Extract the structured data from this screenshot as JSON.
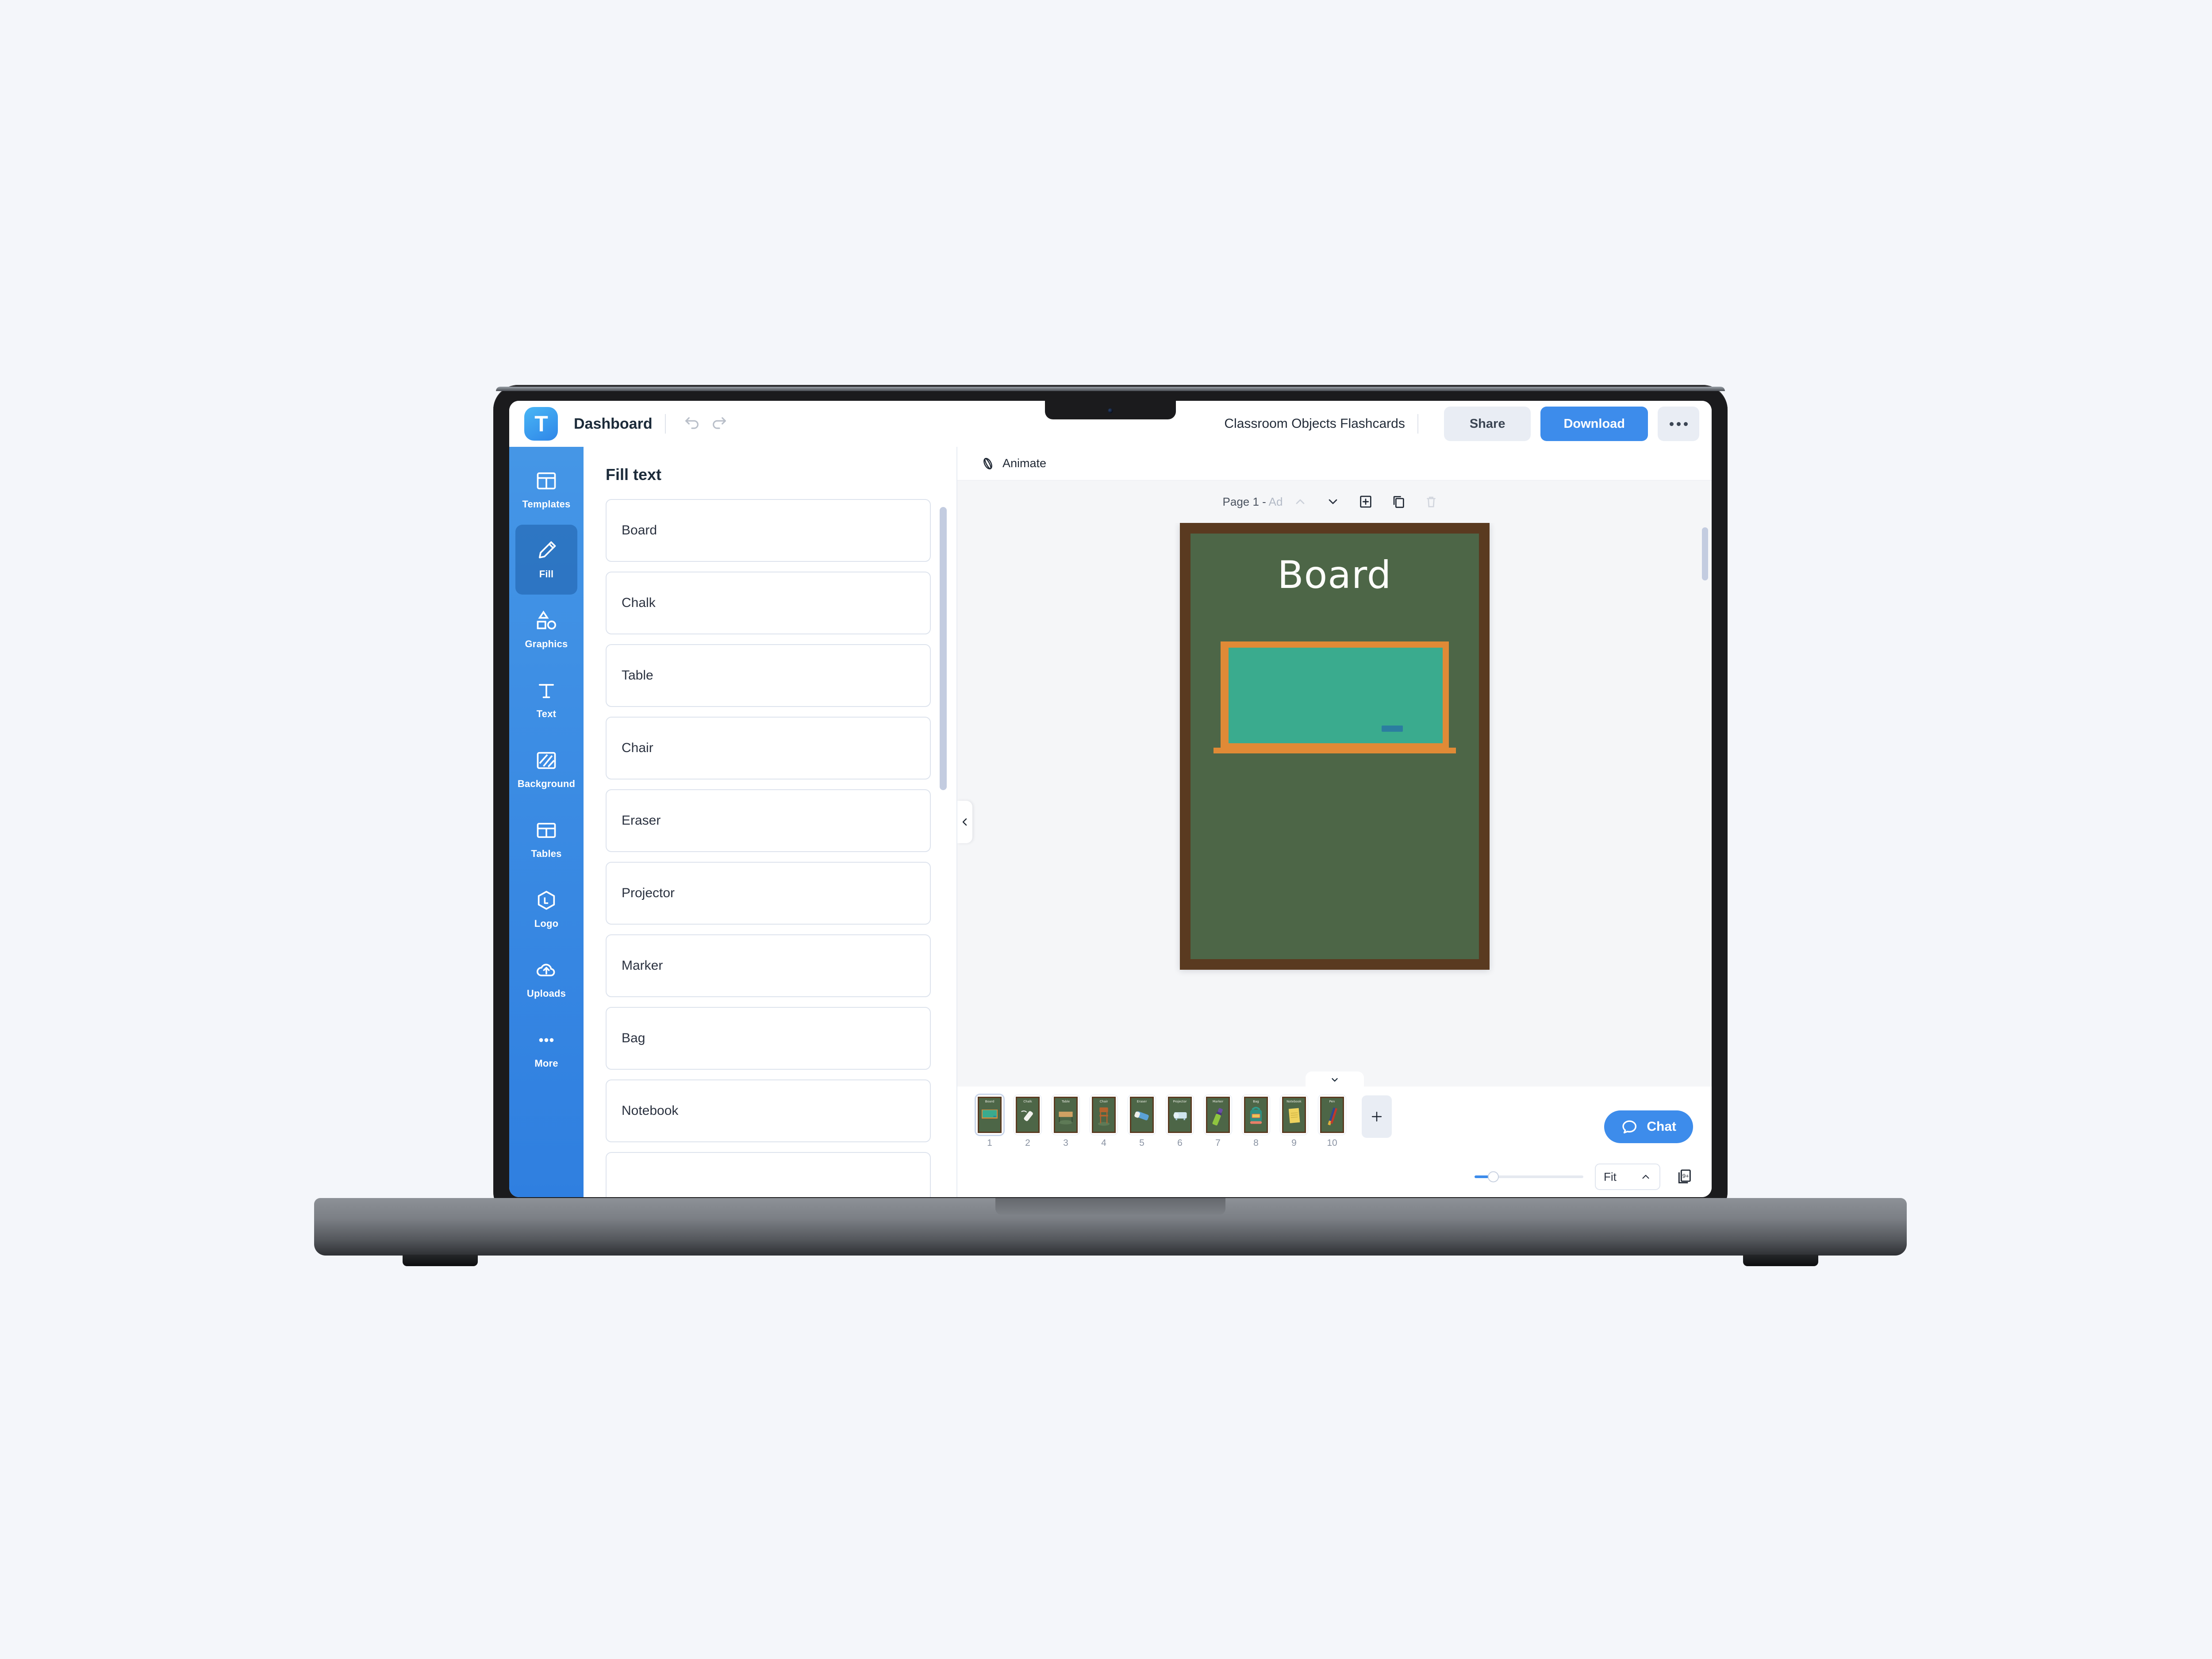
{
  "header": {
    "logo_letter": "T",
    "dashboard_label": "Dashboard",
    "undo_icon": "undo-icon",
    "redo_icon": "redo-icon",
    "doc_title": "Classroom Objects Flashcards",
    "share_label": "Share",
    "download_label": "Download",
    "more_icon": "more-horizontal-icon"
  },
  "sidebar": {
    "items": [
      {
        "label": "Templates",
        "icon": "templates-icon",
        "active": false
      },
      {
        "label": "Fill",
        "icon": "pencil-icon",
        "active": true
      },
      {
        "label": "Graphics",
        "icon": "shapes-icon",
        "active": false
      },
      {
        "label": "Text",
        "icon": "text-icon",
        "active": false
      },
      {
        "label": "Background",
        "icon": "background-icon",
        "active": false
      },
      {
        "label": "Tables",
        "icon": "tables-icon",
        "active": false
      },
      {
        "label": "Logo",
        "icon": "logo-icon",
        "active": false
      },
      {
        "label": "Uploads",
        "icon": "upload-cloud-icon",
        "active": false
      },
      {
        "label": "More",
        "icon": "more-dots-icon",
        "active": false
      }
    ]
  },
  "fill_panel": {
    "title": "Fill text",
    "fields": [
      {
        "value": "Board"
      },
      {
        "value": "Chalk"
      },
      {
        "value": "Table"
      },
      {
        "value": "Chair"
      },
      {
        "value": "Eraser"
      },
      {
        "value": "Projector"
      },
      {
        "value": "Marker"
      },
      {
        "value": "Bag"
      },
      {
        "value": "Notebook"
      },
      {
        "value": ""
      }
    ]
  },
  "editor": {
    "animate_label": "Animate",
    "animate_icon": "animate-icon",
    "page_indicator_prefix": "Page 1 - ",
    "page_indicator_suffix": "Ad",
    "prev_page_icon": "chevron-up-icon",
    "next_page_icon": "chevron-down-icon",
    "add_page_icon": "add-page-icon",
    "duplicate_page_icon": "duplicate-page-icon",
    "delete_page_icon": "trash-icon",
    "collapse_panel_icon": "chevron-left-icon",
    "thumb_toggle_icon": "chevron-down-icon"
  },
  "canvas": {
    "heading": "Board",
    "colors": {
      "wall": "#4d6647",
      "frame": "#5a3a20",
      "board_frame": "#e08a36",
      "board_surface": "#3aab8e",
      "chalk_mark": "#2b7da0",
      "heading_color": "#fdfdfa"
    }
  },
  "thumbnails": {
    "add_page_label": "+",
    "items": [
      {
        "number": "1",
        "caption": "Board",
        "object": "mini-board",
        "selected": true
      },
      {
        "number": "2",
        "caption": "Chalk",
        "object": "chalk",
        "selected": false
      },
      {
        "number": "3",
        "caption": "Table",
        "object": "table",
        "selected": false
      },
      {
        "number": "4",
        "caption": "Chair",
        "object": "chair",
        "selected": false
      },
      {
        "number": "5",
        "caption": "Eraser",
        "object": "eraser",
        "selected": false
      },
      {
        "number": "6",
        "caption": "Projector",
        "object": "projector",
        "selected": false
      },
      {
        "number": "7",
        "caption": "Marker",
        "object": "marker",
        "selected": false
      },
      {
        "number": "8",
        "caption": "Bag",
        "object": "bag",
        "selected": false
      },
      {
        "number": "9",
        "caption": "Notebook",
        "object": "notebook",
        "selected": false
      },
      {
        "number": "10",
        "caption": "Pen",
        "object": "pen",
        "selected": false
      }
    ]
  },
  "zoom_bar": {
    "fit_label": "Fit",
    "fit_chevron_icon": "chevron-up-icon",
    "pages_count_label": "9+",
    "pages_count_icon": "pages-count-icon"
  },
  "chat": {
    "label": "Chat",
    "icon": "chat-bubble-icon"
  },
  "accent": {
    "brand_blue": "#3d8ceb",
    "rail_blue": "#2f7fe0",
    "chip_grey": "#e9edf4",
    "page_bg": "#f4f6fa"
  }
}
